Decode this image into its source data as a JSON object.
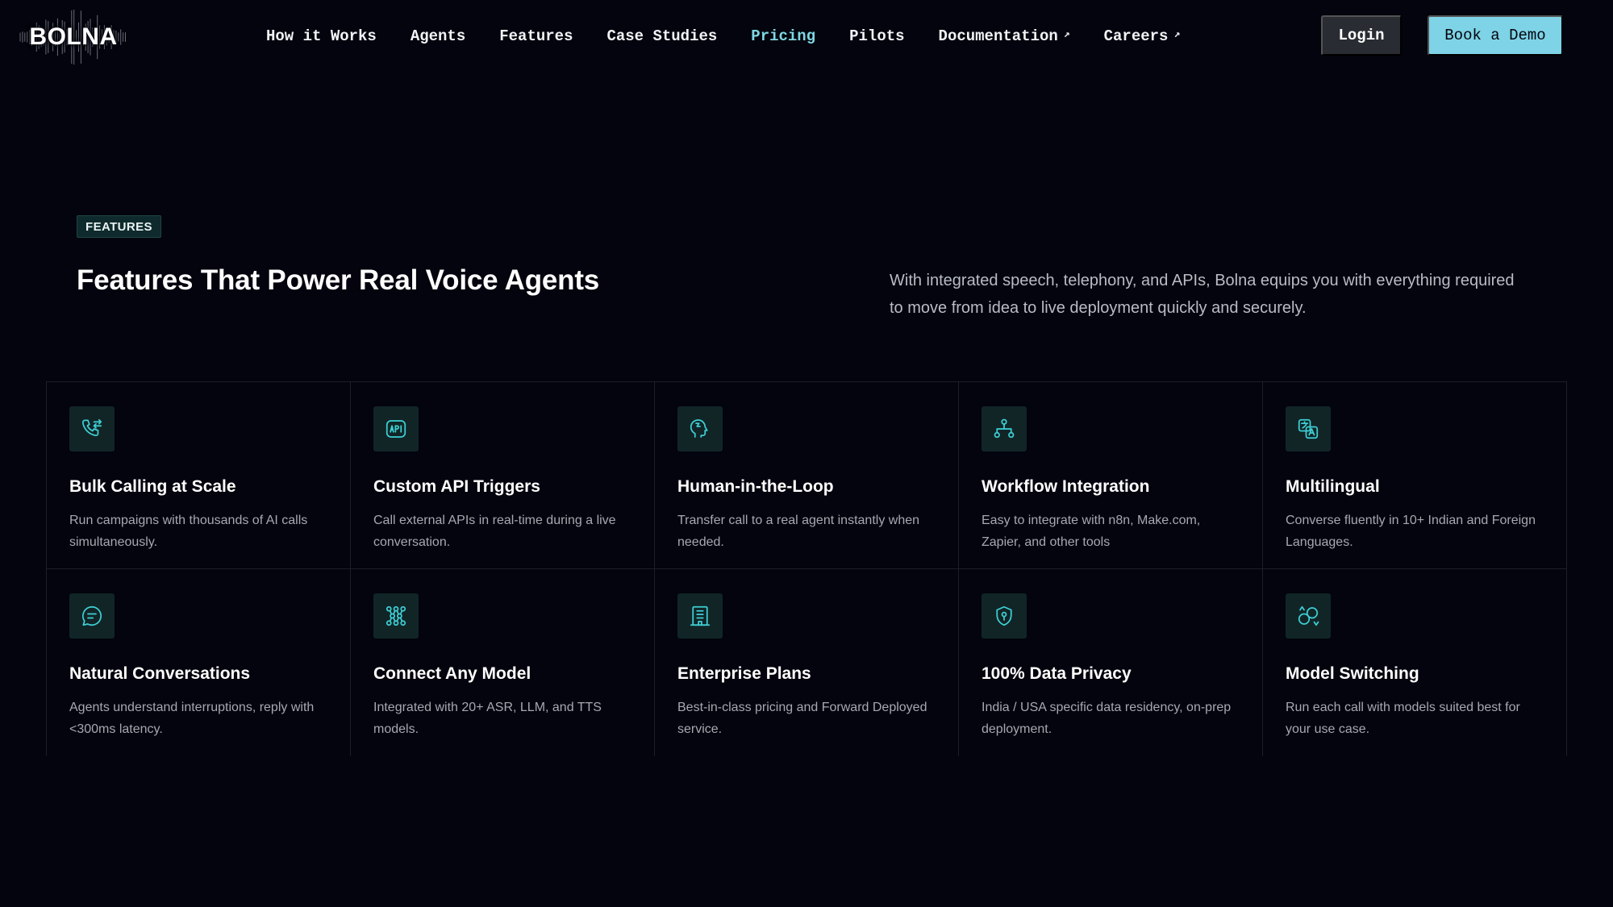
{
  "brand": {
    "logo_text": "BOLNA"
  },
  "nav": {
    "links": [
      {
        "label": "How it Works"
      },
      {
        "label": "Agents"
      },
      {
        "label": "Features"
      },
      {
        "label": "Case Studies"
      },
      {
        "label": "Pricing"
      },
      {
        "label": "Pilots"
      },
      {
        "label": "Documentation"
      },
      {
        "label": "Careers"
      }
    ],
    "login_label": "Login",
    "demo_label": "Book a Demo"
  },
  "section": {
    "badge": "FEATURES",
    "title": "Features That Power Real Voice Agents",
    "intro": "With integrated speech, telephony, and APIs, Bolna equips you with everything required to move from idea to live deployment quickly and securely."
  },
  "features": [
    {
      "icon": "phone-transfer-icon",
      "title": "Bulk Calling at Scale",
      "desc": "Run campaigns with thousands of AI calls simultaneously."
    },
    {
      "icon": "api-icon",
      "title": "Custom API Triggers",
      "desc": "Call external APIs in real-time during a live conversation."
    },
    {
      "icon": "human-head-icon",
      "title": "Human-in-the-Loop",
      "desc": "Transfer call to a real agent instantly when needed."
    },
    {
      "icon": "workflow-icon",
      "title": "Workflow Integration",
      "desc": "Easy to integrate with n8n, Make.com, Zapier, and other tools"
    },
    {
      "icon": "translate-icon",
      "title": "Multilingual",
      "desc": "Converse fluently in 10+ Indian and Foreign Languages."
    },
    {
      "icon": "chat-icon",
      "title": "Natural Conversations",
      "desc": "Agents understand interruptions, reply with <300ms latency."
    },
    {
      "icon": "model-network-icon",
      "title": "Connect Any Model",
      "desc": "Integrated with 20+ ASR, LLM, and TTS models."
    },
    {
      "icon": "building-icon",
      "title": "Enterprise Plans",
      "desc": "Best-in-class pricing and Forward Deployed service."
    },
    {
      "icon": "shield-lock-icon",
      "title": "100% Data Privacy",
      "desc": "India / USA specific data residency, on-prep deployment."
    },
    {
      "icon": "model-switch-icon",
      "title": "Model Switching",
      "desc": "Run each call with models suited best for your use case."
    }
  ],
  "colors": {
    "background": "#03040d",
    "accent": "#7ed3e6",
    "icon": "#3ecfd4",
    "card_border": "#1d1f27"
  }
}
